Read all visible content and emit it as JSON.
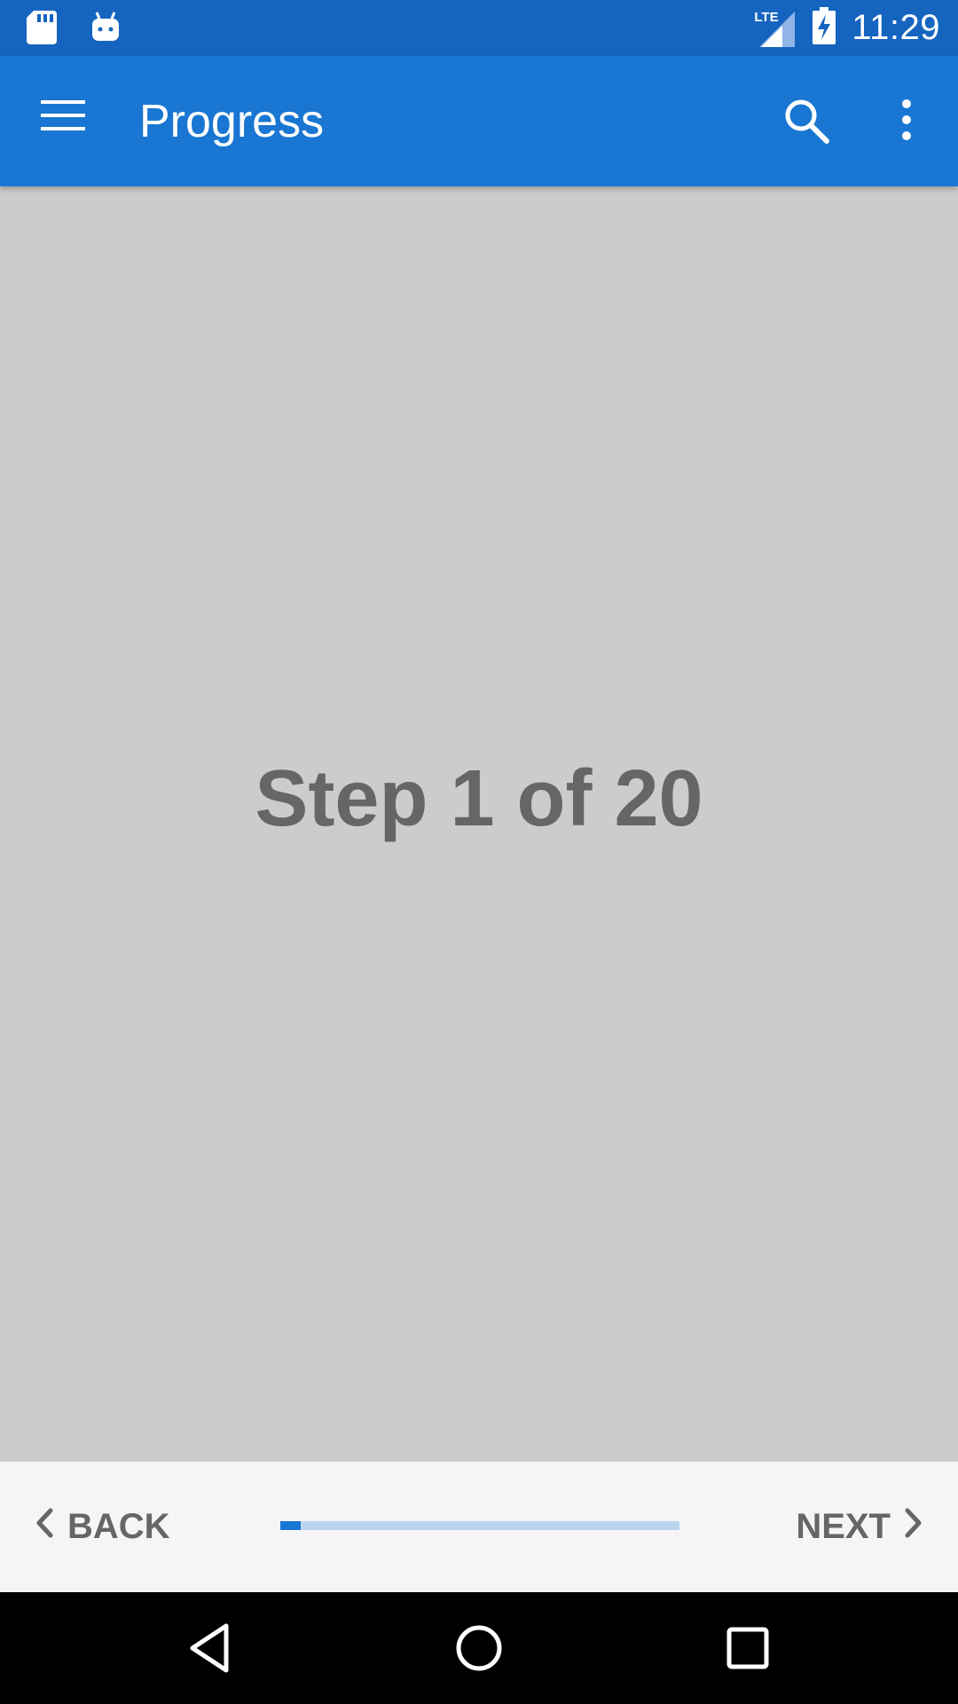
{
  "status_bar": {
    "time": "11:29",
    "network_label": "LTE",
    "icons": [
      "sd-card-icon",
      "android-icon",
      "signal-icon",
      "battery-charging-icon"
    ]
  },
  "app_bar": {
    "title": "Progress",
    "icons": [
      "menu-icon",
      "search-icon",
      "more-vert-icon"
    ]
  },
  "content": {
    "step_text": "Step 1 of 20"
  },
  "bottom_nav": {
    "back_label": "BACK",
    "next_label": "NEXT",
    "progress": {
      "current_step": 1,
      "total_steps": 20
    }
  },
  "system_nav": {
    "icons": [
      "back-triangle-icon",
      "home-circle-icon",
      "recents-square-icon"
    ]
  },
  "colors": {
    "status_bar": "#1565c0",
    "app_bar": "#1976d2",
    "content_bg": "#cccccc",
    "step_text": "#666666",
    "progress_fill": "#1976d2",
    "progress_track": "#bbd4ee"
  }
}
